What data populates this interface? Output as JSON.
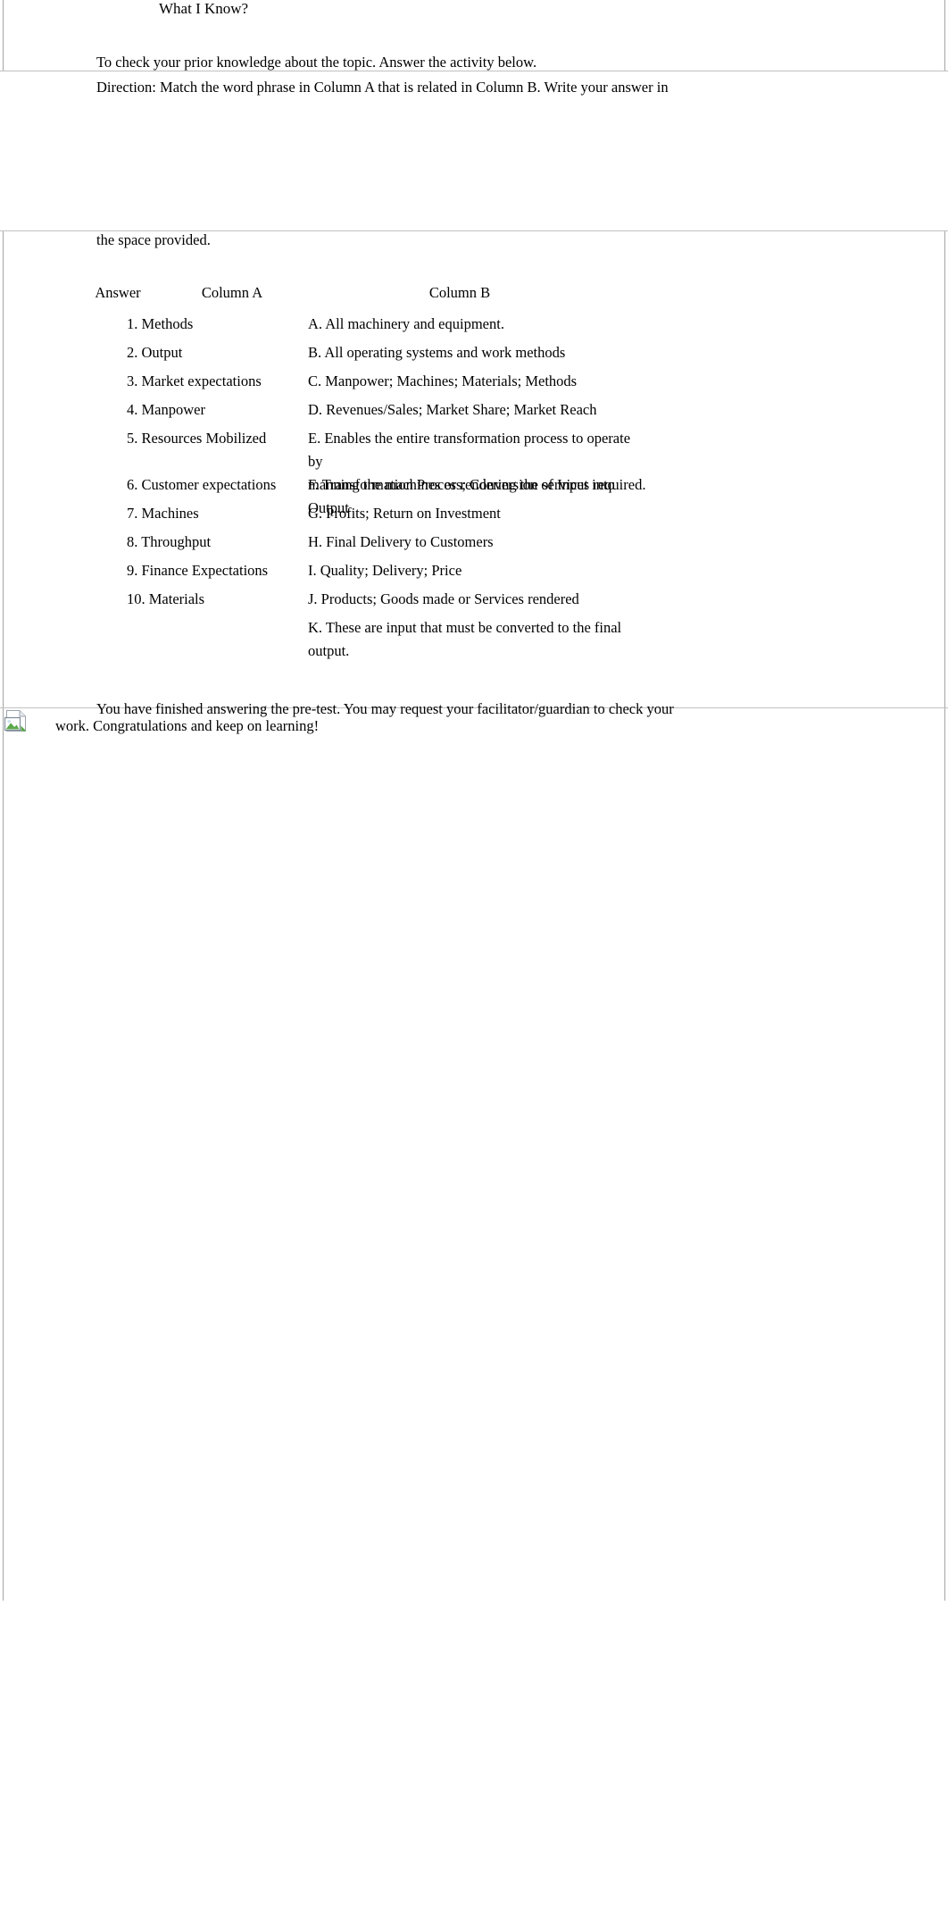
{
  "document": {
    "title": "What I Know?",
    "intro": "To check your prior knowledge about the topic. Answer the activity below.",
    "direction": "Direction:  Match the word phrase in Column A that is related in Column B. Write your answer in",
    "direction_continued": "the space provided.",
    "closing_line1": "You have finished answering the pre-test. You may request your facilitator/guardian to check your",
    "closing_line2": "work. Congratulations and keep on learning!"
  },
  "table": {
    "headers": {
      "answer": "Answer",
      "column_a": "Column A",
      "column_b": "Column B"
    },
    "column_a_items": [
      "1. Methods",
      "2. Output",
      "3. Market expectations",
      "4. Manpower",
      "5. Resources Mobilized",
      "6. Customer expectations",
      "7. Machines",
      "8. Throughput",
      "9. Finance Expectations",
      "10. Materials"
    ],
    "column_b_items": [
      "A. All machinery and equipment.",
      "B. All operating systems and work methods",
      "C. Manpower; Machines; Materials; Methods",
      "D. Revenues/Sales; Market Share; Market Reach",
      "E. Enables the entire transformation process to operate by",
      "F. Transformation Process; Conversion of Input into Output",
      "G. Profits; Return on Investment",
      "H. Final Delivery to Customers",
      "I. Quality; Delivery; Price",
      "J. Products; Goods made or Services rendered",
      "K. These are input that must be converted to the final output."
    ],
    "column_b_item_e_line2": "manning the machines or rendering the services required.",
    "answers": [
      "",
      "",
      "",
      "",
      "",
      "",
      "",
      "",
      "",
      ""
    ]
  },
  "media": {
    "broken_image_icon": "broken-image-icon"
  },
  "colors": {
    "text": "#000000",
    "background": "#ffffff",
    "rule": "#c0c0c0",
    "frame": "#a6a6a6"
  }
}
